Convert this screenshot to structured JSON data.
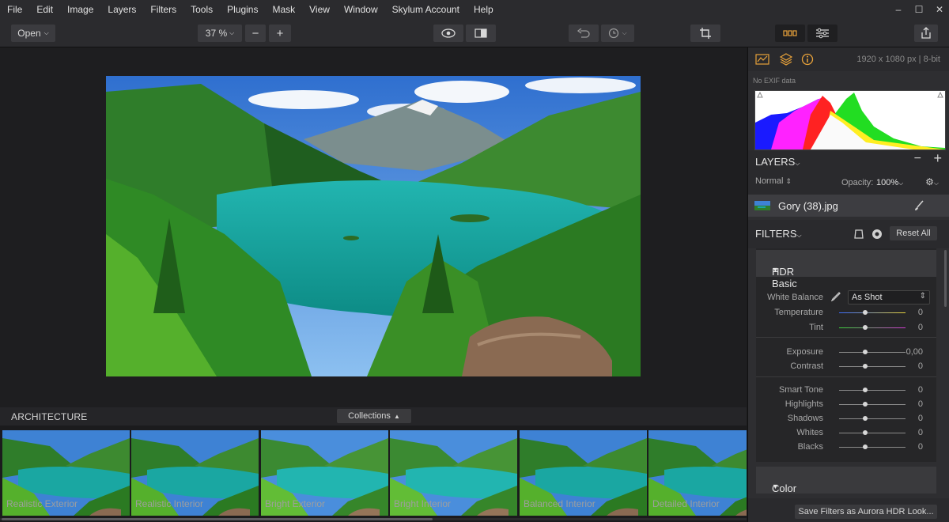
{
  "menu": [
    "File",
    "Edit",
    "Image",
    "Layers",
    "Filters",
    "Tools",
    "Plugins",
    "Mask",
    "View",
    "Window",
    "Skylum Account",
    "Help"
  ],
  "window_buttons": {
    "minimize": "–",
    "maximize": "☐",
    "close": "✕"
  },
  "toolbar": {
    "open_label": "Open",
    "zoom_value": "37 %",
    "zoom_out": "−",
    "zoom_in": "+"
  },
  "colors": {
    "accent": "#e8a23a",
    "background": "#1b1b1d",
    "panel": "#2e2e31"
  },
  "strip": {
    "title": "ARCHITECTURE",
    "collections_label": "Collections",
    "presets": [
      "Realistic Exterior",
      "Realistic Interior",
      "Bright Exterior",
      "Bright Interior",
      "Balanced Interior",
      "Detailed Interior"
    ]
  },
  "panel": {
    "dimensions": "1920 x 1080 px  |  8-bit",
    "exif": "No EXIF data",
    "layers": {
      "title": "LAYERS",
      "blend_mode": "Normal",
      "opacity_label": "Opacity:",
      "opacity_value": "100%",
      "layer_name": "Gory (38).jpg"
    },
    "filters": {
      "title": "FILTERS",
      "reset_all": "Reset All",
      "hdr_basic": "HDR Basic",
      "white_balance_label": "White Balance",
      "white_balance_value": "As Shot",
      "groups": [
        {
          "label": "Temperature",
          "value": "0"
        },
        {
          "label": "Tint",
          "value": "0"
        },
        {
          "label": "Exposure",
          "value": "0,00"
        },
        {
          "label": "Contrast",
          "value": "0"
        },
        {
          "label": "Smart Tone",
          "value": "0"
        },
        {
          "label": "Highlights",
          "value": "0"
        },
        {
          "label": "Shadows",
          "value": "0"
        },
        {
          "label": "Whites",
          "value": "0"
        },
        {
          "label": "Blacks",
          "value": "0"
        }
      ],
      "color_section": "Color",
      "save_button": "Save Filters as Aurora HDR Look..."
    }
  }
}
